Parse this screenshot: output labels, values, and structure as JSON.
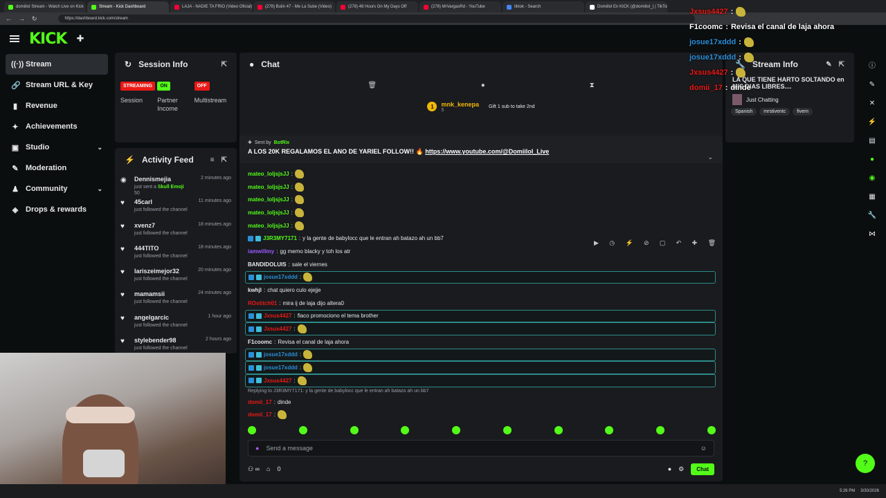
{
  "browser": {
    "tabs": [
      {
        "title": "domiiloI Stream - Watch Live on Kick",
        "fav": "#53fc18"
      },
      {
        "title": "Stream - Kick Dashboard",
        "fav": "#53fc18"
      },
      {
        "title": "LAJA - NADIE TA FRIO (Video Oficial)",
        "fav": "#ff0033"
      },
      {
        "title": "(278) Bulin 47 - Me La Sube (Video)",
        "fav": "#ff0033"
      },
      {
        "title": "(278) 48 Hours On My Days Off",
        "fav": "#ff0033"
      },
      {
        "title": "(278) MrVargasRd - YouTube",
        "fav": "#ff0033"
      },
      {
        "title": "tiktok - Search",
        "fav": "#4285f4"
      },
      {
        "title": "Domiilol En KICK (@domiilol_) | TikTok",
        "fav": "#ffffff"
      }
    ],
    "url": "https://dashboard.kick.com/stream"
  },
  "brand": {
    "logo": "KICK",
    "accent": "#53fc18"
  },
  "sidebar": {
    "items": [
      {
        "label": "Stream",
        "icon": "broadcast-icon",
        "glyph": "((·))",
        "active": true
      },
      {
        "label": "Stream URL & Key",
        "icon": "link-icon",
        "glyph": "🔗"
      },
      {
        "label": "Revenue",
        "icon": "chart-icon",
        "glyph": "▮"
      },
      {
        "label": "Achievements",
        "icon": "trophy-icon",
        "glyph": "✦"
      },
      {
        "label": "Studio",
        "icon": "studio-icon",
        "glyph": "▣",
        "chevron": true
      },
      {
        "label": "Moderation",
        "icon": "sword-icon",
        "glyph": "✎"
      },
      {
        "label": "Community",
        "icon": "community-icon",
        "glyph": "♟",
        "chevron": true
      },
      {
        "label": "Drops & rewards",
        "icon": "gift-icon",
        "glyph": "◈"
      }
    ]
  },
  "session": {
    "title": "Session Info",
    "cols": [
      {
        "badge": "STREAMING",
        "label": "Session",
        "color": "red"
      },
      {
        "badge": "ON",
        "label": "Partner Income",
        "color": "green"
      },
      {
        "badge": "OFF",
        "label": "Multistream",
        "color": "red"
      }
    ]
  },
  "activity": {
    "title": "Activity Feed",
    "items": [
      {
        "name": "Dennismejia",
        "time": "2 minutes ago",
        "desc": "just sent a",
        "extra": "Skull Emoji",
        "amount": "50",
        "icon": "kick-coin-icon"
      },
      {
        "name": "45carl",
        "time": "11 minutes ago",
        "desc": "just followed the channel",
        "icon": "heart-icon"
      },
      {
        "name": "xvenz7",
        "time": "18 minutes ago",
        "desc": "just followed the channel",
        "icon": "heart-icon"
      },
      {
        "name": "444TITO",
        "time": "18 minutes ago",
        "desc": "just followed the channel",
        "icon": "heart-icon"
      },
      {
        "name": "lariszeimejor32",
        "time": "20 minutes ago",
        "desc": "just followed the channel",
        "icon": "heart-icon"
      },
      {
        "name": "mamamsii",
        "time": "24 minutes ago",
        "desc": "just followed the channel",
        "icon": "heart-icon"
      },
      {
        "name": "angelgarcic",
        "time": "1 hour ago",
        "desc": "just followed the channel",
        "icon": "heart-icon"
      },
      {
        "name": "stylebender98",
        "time": "2 hours ago",
        "desc": "just followed the channel",
        "icon": "heart-icon"
      }
    ]
  },
  "chat": {
    "title": "Chat",
    "gift": {
      "name": "mnk_kenepa",
      "sub": "5",
      "text": "Gift 1 sub to take 2nd"
    },
    "pinned": {
      "sent_by": "Sent by",
      "bot": "BotRix",
      "message": "A LOS 20K REGALAMOS EL ANO DE YARIEL FOLLOW!! 🔥",
      "link": "https://www.youtube.com/@DomiiloI_Live"
    },
    "messages": [
      {
        "user": "mateo_loljsjsJJ",
        "text": "",
        "emote": true,
        "color": "#53fc18"
      },
      {
        "user": "mateo_loljsjsJJ",
        "text": "",
        "emote": true,
        "color": "#53fc18"
      },
      {
        "user": "mateo_loljsjsJJ",
        "text": "",
        "emote": true,
        "color": "#53fc18"
      },
      {
        "user": "mateo_loljsjsJJ",
        "text": "",
        "emote": true,
        "color": "#53fc18"
      },
      {
        "user": "mateo_loljsjsJJ",
        "text": "",
        "emote": true,
        "color": "#53fc18"
      },
      {
        "user": "J3R3MY7171",
        "text": "y la gente de babylocc que le entran ah batazo ah un bb7",
        "color": "#53fc18",
        "badge": true
      },
      {
        "user": "iamwillmy",
        "text": "gg memo blacky y toh los atr",
        "color": "#9b59ff"
      },
      {
        "user": "BANDIDOLUIS",
        "text": "sale el viernes",
        "color": "#e6e8ea"
      },
      {
        "user": "josue17xddd",
        "text": "",
        "emote": true,
        "color": "#2a8fd9",
        "hl": true,
        "badge": true
      },
      {
        "user": "kwhjl",
        "text": "chat quiero culo ejejje",
        "color": "#e6e8ea"
      },
      {
        "user": "ROstitch01",
        "text": "mira ij de laja dijo altera0",
        "color": "#e91916"
      },
      {
        "user": "Jxsus4427",
        "text": "flaco promociono el tema brother",
        "color": "#e91916",
        "hl": true,
        "badge": true
      },
      {
        "user": "Jxsus4427",
        "text": "",
        "emote": true,
        "color": "#e91916",
        "hl": true,
        "badge": true
      },
      {
        "user": "F1coomc",
        "text": "Revisa el canal de laja ahora",
        "color": "#e6e8ea"
      },
      {
        "user": "josue17xddd",
        "text": "",
        "emote": true,
        "color": "#2a8fd9",
        "hl": true,
        "badge": true
      },
      {
        "user": "josue17xddd",
        "text": "",
        "emote": true,
        "color": "#2a8fd9",
        "hl": true,
        "badge": true
      },
      {
        "user": "Jxsus4427",
        "text": "",
        "emote": true,
        "color": "#e91916",
        "hl": true,
        "badge": true
      }
    ],
    "reply": "Replying to J3R3MY7171: y la gente de babylocc que le entran ah batazo ah un bb7",
    "replies": [
      {
        "user": "domii_17",
        "text": "dinde",
        "color": "#e91916"
      },
      {
        "user": "domii_17",
        "text": "",
        "color": "#e91916"
      }
    ],
    "input_placeholder": "Send a message",
    "chat_button": "Chat",
    "points": "0"
  },
  "stream_info": {
    "title": "Stream Info",
    "stream_title": "LA QUE TIENE HARTO SOLTANDO en MIS DIAS LIBRES....",
    "category": "Just Chatting",
    "tags": [
      "Spanish",
      "mrstiventc",
      "fivem"
    ]
  },
  "overlay": {
    "lines": [
      {
        "user": "Jxsus4427",
        "text": "",
        "color": "#e91916",
        "emote": true
      },
      {
        "user": "F1coomc",
        "text": "Revisa el canal de laja ahora",
        "color": "#ffffff"
      },
      {
        "user": "josue17xddd",
        "text": "",
        "color": "#2a8fd9",
        "emote": true
      },
      {
        "user": "josue17xddd",
        "text": "",
        "color": "#2a8fd9",
        "emote": true
      },
      {
        "user": "Jxsus4427",
        "text": "",
        "color": "#e91916",
        "emote": true
      },
      {
        "user": "domii_17",
        "text": "dinde",
        "color": "#e91916"
      }
    ]
  },
  "taskbar": {
    "time": "5:26 PM",
    "date": "3/30/2026"
  }
}
